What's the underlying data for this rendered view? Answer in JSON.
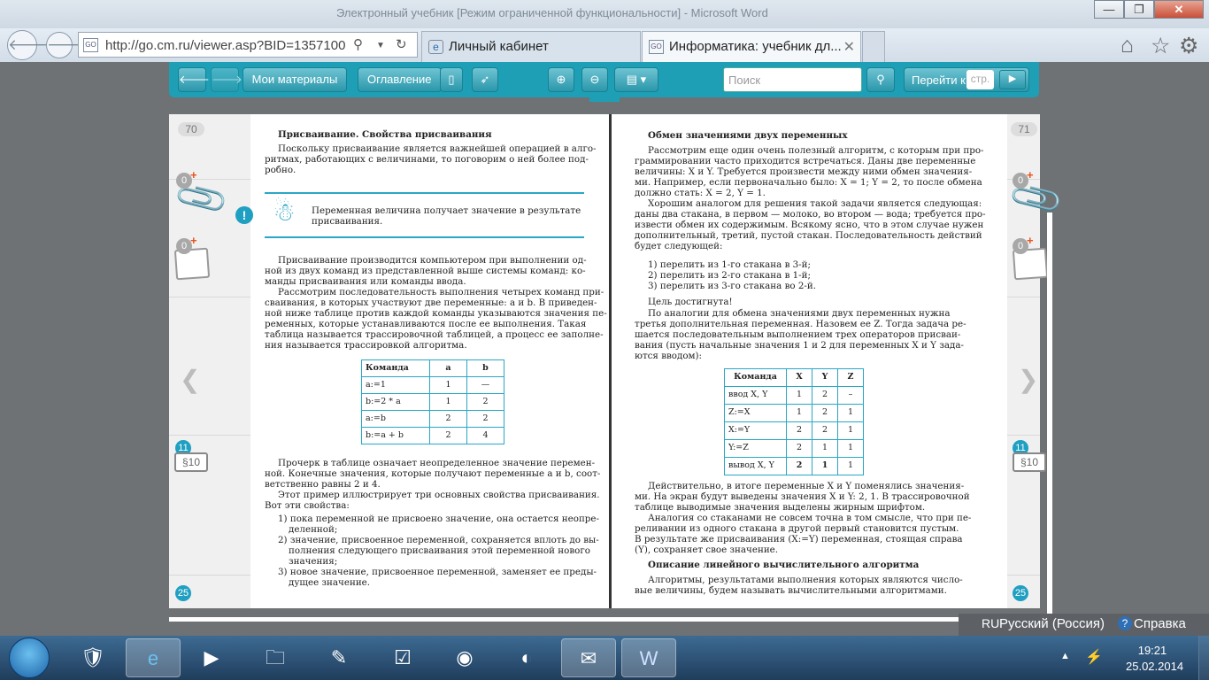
{
  "window": {
    "title": "Электронный учебник [Режим ограниченной функциональности] - Microsoft Word"
  },
  "browser": {
    "url": "http://go.cm.ru/viewer.asp?BID=1357100",
    "tabs": [
      {
        "label": "Личный кабинет"
      },
      {
        "label": "Информатика: учебник дл..."
      }
    ],
    "favicon_text": "GO"
  },
  "viewer_toolbar": {
    "my_materials": "Мои материалы",
    "contents": "Оглавление",
    "search_placeholder": "Поиск",
    "goto_label": "Перейти к",
    "page_placeholder": "стр."
  },
  "left_page": {
    "page_number": "70",
    "badges": [
      "0",
      "0",
      "11",
      "25"
    ],
    "section_label": "§10",
    "heading": "Присваивание. Свойства присваивания",
    "intro": [
      "Поскольку присваивание является важнейшей операцией в алго-",
      "ритмах, работающих с величинами, то поговорим о ней более под-",
      "робно."
    ],
    "callout": [
      "Переменная величина получает значение в результате",
      "присваивания."
    ],
    "para1": [
      "Присваивание производится компьютером при выполнении од-",
      "ной из двух команд из представленной выше системы команд: ко-",
      "манды присваивания или команды ввода."
    ],
    "para2": [
      "Рассмотрим последовательность выполнения четырех команд при-",
      "сваивания, в которых участвуют две переменные: a и b. В приведен-",
      "ной ниже таблице против каждой команды указываются значения пе-",
      "ременных, которые устанавливаются после ее выполнения. Такая",
      "таблица называется трассировочной таблицей, а процесс ее заполне-",
      "ния называется трассировкой алгоритма."
    ],
    "table": {
      "headers": [
        "Команда",
        "a",
        "b"
      ],
      "rows": [
        [
          "a:=1",
          "1",
          "—"
        ],
        [
          "b:=2 * a",
          "1",
          "2"
        ],
        [
          "a:=b",
          "2",
          "2"
        ],
        [
          "b:=a + b",
          "2",
          "4"
        ]
      ]
    },
    "para3": [
      "Прочерк в таблице означает неопределенное значение перемен-",
      "ной. Конечные значения, которые получают переменные a и b, соот-",
      "ветственно равны 2 и 4.",
      "Этот пример иллюстрирует три основных свойства присваивания.",
      "Вот эти свойства:"
    ],
    "list": [
      "1) пока переменной не присвоено значение, она остается неопре-",
      "деленной;",
      "2) значение, присвоенное переменной, сохраняется вплоть до вы-",
      "полнения следующего присваивания этой переменной нового",
      "значения;",
      "3) новое значение, присвоенное переменной, заменяет ее преды-",
      "дущее значение."
    ]
  },
  "right_page": {
    "page_number": "71",
    "heading": "Обмен значениями двух переменных",
    "para1": [
      "Рассмотрим еще один очень полезный алгоритм, с которым при про-",
      "граммировании часто приходится встречаться. Даны две переменные",
      "величины: X и Y. Требуется произвести между ними обмен значения-",
      "ми. Например, если первоначально было: X = 1; Y = 2, то после обмена",
      "должно стать: X = 2, Y = 1.",
      "Хорошим аналогом для решения такой задачи является следующая:",
      "даны два стакана, в первом — молоко, во втором — вода; требуется про-",
      "извести обмен их содержимым. Всякому ясно, что в этом случае нужен",
      "дополнительный, третий, пустой стакан. Последовательность действий",
      "будет следующей:"
    ],
    "steps": [
      "1) перелить из 1-го стакана в 3-й;",
      "2) перелить из 2-го стакана в 1-й;",
      "3) перелить из 3-го стакана во 2-й."
    ],
    "para2": [
      "Цель достигнута!",
      "По аналогии для обмена значениями двух переменных нужна",
      "третья дополнительная переменная. Назовем ее Z. Тогда задача ре-",
      "шается последовательным выполнением трех операторов присваи-",
      "вания (пусть начальные значения 1 и 2 для переменных X и Y зада-",
      "ются вводом):"
    ],
    "table": {
      "headers": [
        "Команда",
        "X",
        "Y",
        "Z"
      ],
      "rows": [
        [
          "ввод X, Y",
          "1",
          "2",
          "–"
        ],
        [
          "Z:=X",
          "1",
          "2",
          "1"
        ],
        [
          "X:=Y",
          "2",
          "2",
          "1"
        ],
        [
          "Y:=Z",
          "2",
          "1",
          "1"
        ],
        [
          "вывод X, Y",
          "2",
          "1",
          "1"
        ]
      ]
    },
    "para3": [
      "Действительно, в итоге переменные X и Y поменялись значения-",
      "ми. На экран будут выведены значения X и Y: 2, 1. В трассировочной",
      "таблице выводимые значения выделены жирным шрифтом.",
      "Аналогия со стаканами не совсем точна в том смысле, что при пе-",
      "реливании из одного стакана в другой первый становится пустым.",
      "В результате же присваивания (X:=Y) переменная, стоящая справа",
      "(Y), сохраняет свое значение."
    ],
    "heading2": "Описание линейного вычислительного алгоритма",
    "para4": [
      "Алгоритмы, результатами выполнения которых являются число-",
      "вые величины, будем называть вычислительными алгоритмами."
    ],
    "badges": [
      "0",
      "0",
      "11",
      "25"
    ],
    "section_label": "§10"
  },
  "language_bar": {
    "lang_code": "RU",
    "lang_name": "Русский (Россия)",
    "help": "Справка"
  },
  "taskbar": {
    "time": "19:21",
    "date": "25.02.2014"
  }
}
